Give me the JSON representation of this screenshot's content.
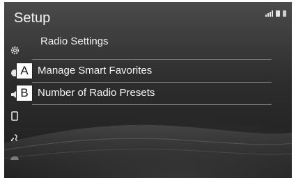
{
  "header": {
    "title": "Setup",
    "status_icons": [
      "signal-icon",
      "battery-icon",
      "status-icon"
    ]
  },
  "sidebar": {
    "icons": [
      "gear-icon",
      "speaker-icon",
      "phone-icon",
      "voice-icon",
      "car-icon"
    ]
  },
  "main": {
    "section_title": "Radio Settings",
    "items": [
      {
        "callout": "A",
        "label": "Manage Smart Favorites"
      },
      {
        "callout": "B",
        "label": "Number of Radio Presets"
      }
    ]
  },
  "colors": {
    "screen_top": "#4a4a4a",
    "screen_bottom": "#1e1e1e",
    "text": "#f5f5f5",
    "divider": "#7a7a7a",
    "callout_bg": "#ffffff"
  }
}
